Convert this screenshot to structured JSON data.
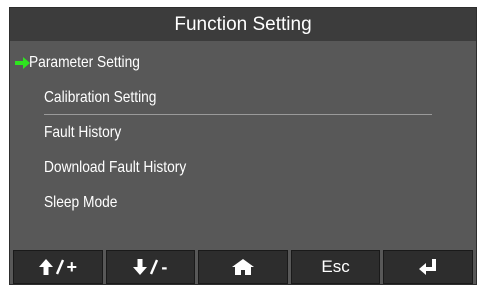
{
  "title": "Function Setting",
  "menu": {
    "selected_index": 0,
    "items": [
      {
        "label": "Parameter Setting"
      },
      {
        "label": "Calibration Setting"
      },
      {
        "label": "Fault History"
      },
      {
        "label": "Download Fault History"
      },
      {
        "label": "Sleep Mode"
      }
    ]
  },
  "colors": {
    "selection_arrow": "#2ee51f",
    "background": "#585858",
    "title_bar": "#3c3c3c",
    "button": "#2d2d2d"
  },
  "buttons": [
    {
      "icon": "arrow-up-icon",
      "symbol": "+"
    },
    {
      "icon": "arrow-down-icon",
      "symbol": "-"
    },
    {
      "icon": "home-icon"
    },
    {
      "label": "Esc"
    },
    {
      "icon": "enter-icon"
    }
  ]
}
